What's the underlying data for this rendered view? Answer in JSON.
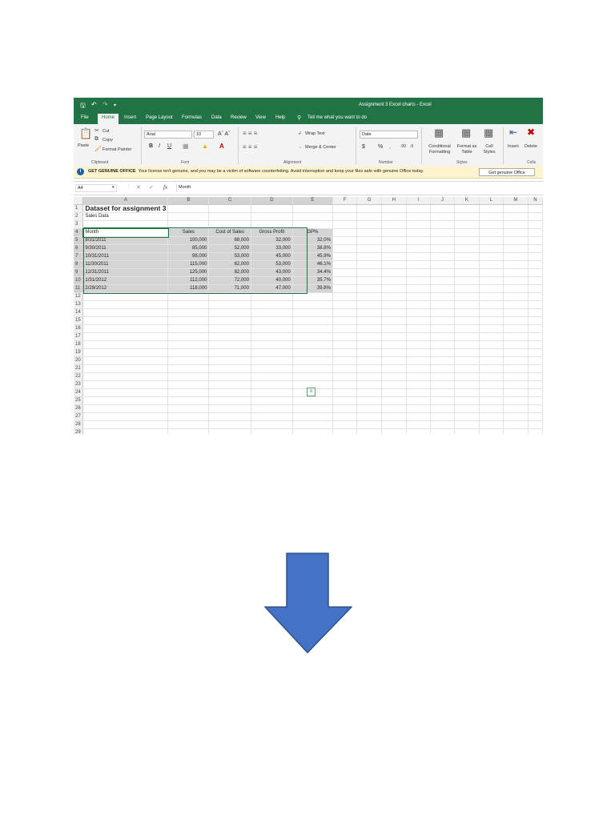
{
  "window": {
    "title": "Assignment 3 Excel charts  -  Excel"
  },
  "menu": {
    "tabs": [
      "File",
      "Home",
      "Insert",
      "Page Layout",
      "Formulas",
      "Data",
      "Review",
      "View",
      "Help"
    ],
    "tell_me": "Tell me what you want to do"
  },
  "ribbon": {
    "paste": "Paste",
    "cut": "Cut",
    "copy": "Copy",
    "format_painter": "Format Painter",
    "clipboard_label": "Clipboard",
    "font_name": "Arial",
    "font_size": "10",
    "font_label": "Font",
    "wrap_text": "Wrap Text",
    "merge_center": "Merge & Center",
    "alignment_label": "Alignment",
    "number_format": "Date",
    "number_label": "Number",
    "conditional_formatting": "Conditional Formatting",
    "format_as_table": "Format as Table",
    "cell_styles": "Cell Styles",
    "styles_label": "Styles",
    "insert": "Insert",
    "delete": "Delete",
    "cells_label": "Cells"
  },
  "infobar": {
    "badge": "GET GENUINE OFFICE",
    "message": "Your license isn't genuine, and you may be a victim of software counterfeiting. Avoid interruption and keep your files safe with genuine Office today.",
    "button": "Get genuine Office"
  },
  "formula_bar": {
    "name_box": "A4",
    "content": "Month"
  },
  "sheet": {
    "columns": [
      "A",
      "B",
      "C",
      "D",
      "E",
      "F",
      "G",
      "H",
      "I",
      "J",
      "K",
      "L",
      "M",
      "N"
    ],
    "title": "Dataset for assignment 3",
    "subtitle": "Sales Data",
    "headers": [
      "Month",
      "Sales",
      "Cost of Sales",
      "Gross Profit",
      "GP%"
    ],
    "rows": [
      [
        "8/31/2011",
        "100,000",
        "68,000",
        "32,000",
        "32.0%"
      ],
      [
        "9/30/2011",
        "85,000",
        "52,000",
        "33,000",
        "38.8%"
      ],
      [
        "10/31/2011",
        "98,000",
        "53,000",
        "45,000",
        "45.9%"
      ],
      [
        "11/30/2011",
        "115,000",
        "62,000",
        "53,000",
        "46.1%"
      ],
      [
        "12/31/2011",
        "125,000",
        "82,000",
        "43,000",
        "34.4%"
      ],
      [
        "1/31/2012",
        "112,000",
        "72,000",
        "40,000",
        "35.7%"
      ],
      [
        "2/28/2012",
        "118,000",
        "71,000",
        "47,000",
        "39.8%"
      ]
    ],
    "row_count": 30
  },
  "colors": {
    "excel_green": "#217346",
    "arrow_fill": "#4472c4",
    "arrow_stroke": "#2f528f"
  }
}
